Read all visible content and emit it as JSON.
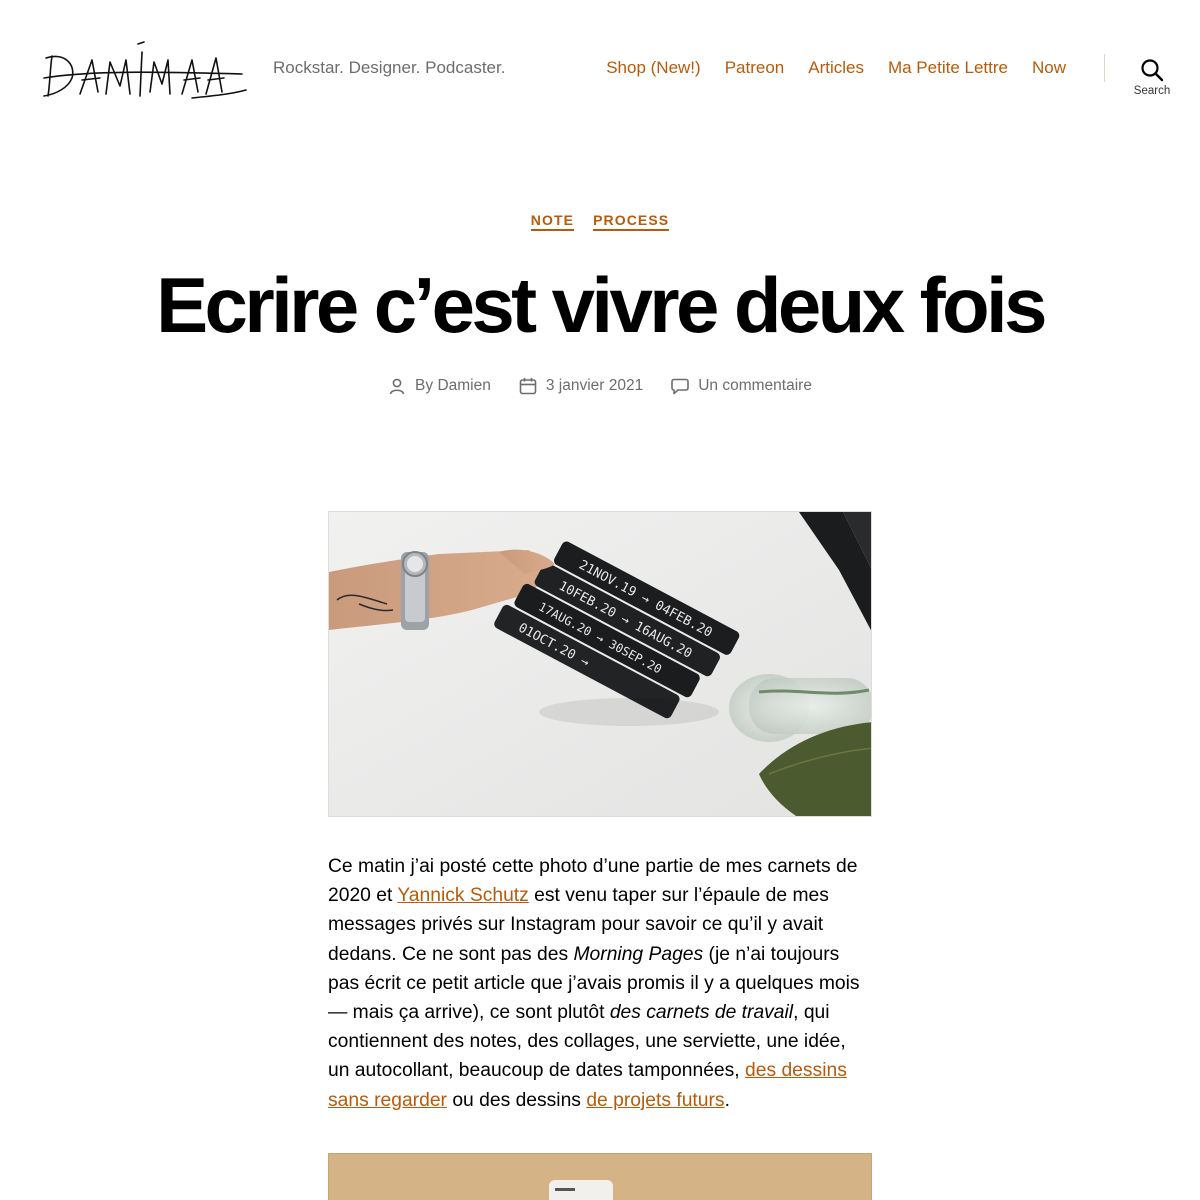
{
  "header": {
    "logo_alt": "DAMIEN",
    "tagline": "Rockstar. Designer. Podcaster.",
    "nav": [
      "Shop (New!)",
      "Patreon",
      "Articles",
      "Ma Petite Lettre",
      "Now"
    ],
    "search_label": "Search"
  },
  "post": {
    "categories": [
      "NOTE",
      "PROCESS"
    ],
    "title": "Ecrire c’est vivre deux fois",
    "meta": {
      "author": "By Damien",
      "date": "3 janvier 2021",
      "comments": "Un commentaire"
    },
    "hero_image": {
      "notebook_labels": [
        "21NOV.19 → 04FEB.20",
        "10FEB.20 → 16AUG.20",
        "17AUG.20 → 30SEP.20",
        "01OCT.20 →"
      ]
    },
    "paragraph": {
      "p1": "Ce matin j’ai posté cette photo d’une partie de mes carnets de 2020 et ",
      "link1": "Yannick Schutz",
      "p2": " est venu taper sur l’épaule de mes messages privés sur Instagram pour savoir ce qu’il y avait dedans. Ce ne sont pas des ",
      "em1": "Morning Pages",
      "p3": " (je n’ai toujours pas écrit ce petit article que j’avais promis il y a quelques mois — mais ça arrive), ce sont plutôt ",
      "em2": "des carnets de travail",
      "p4": ", qui contiennent des notes, des collages, une serviette, une idée, un autocollant, beaucoup de dates tamponnées, ",
      "link2": "des dessins sans regarder",
      "p5": " ou des dessins ",
      "link3": "de projets futurs",
      "p6": "."
    }
  },
  "colors": {
    "accent": "#b85a0a",
    "meta_gray": "#6d6d6d",
    "title": "#000000"
  }
}
